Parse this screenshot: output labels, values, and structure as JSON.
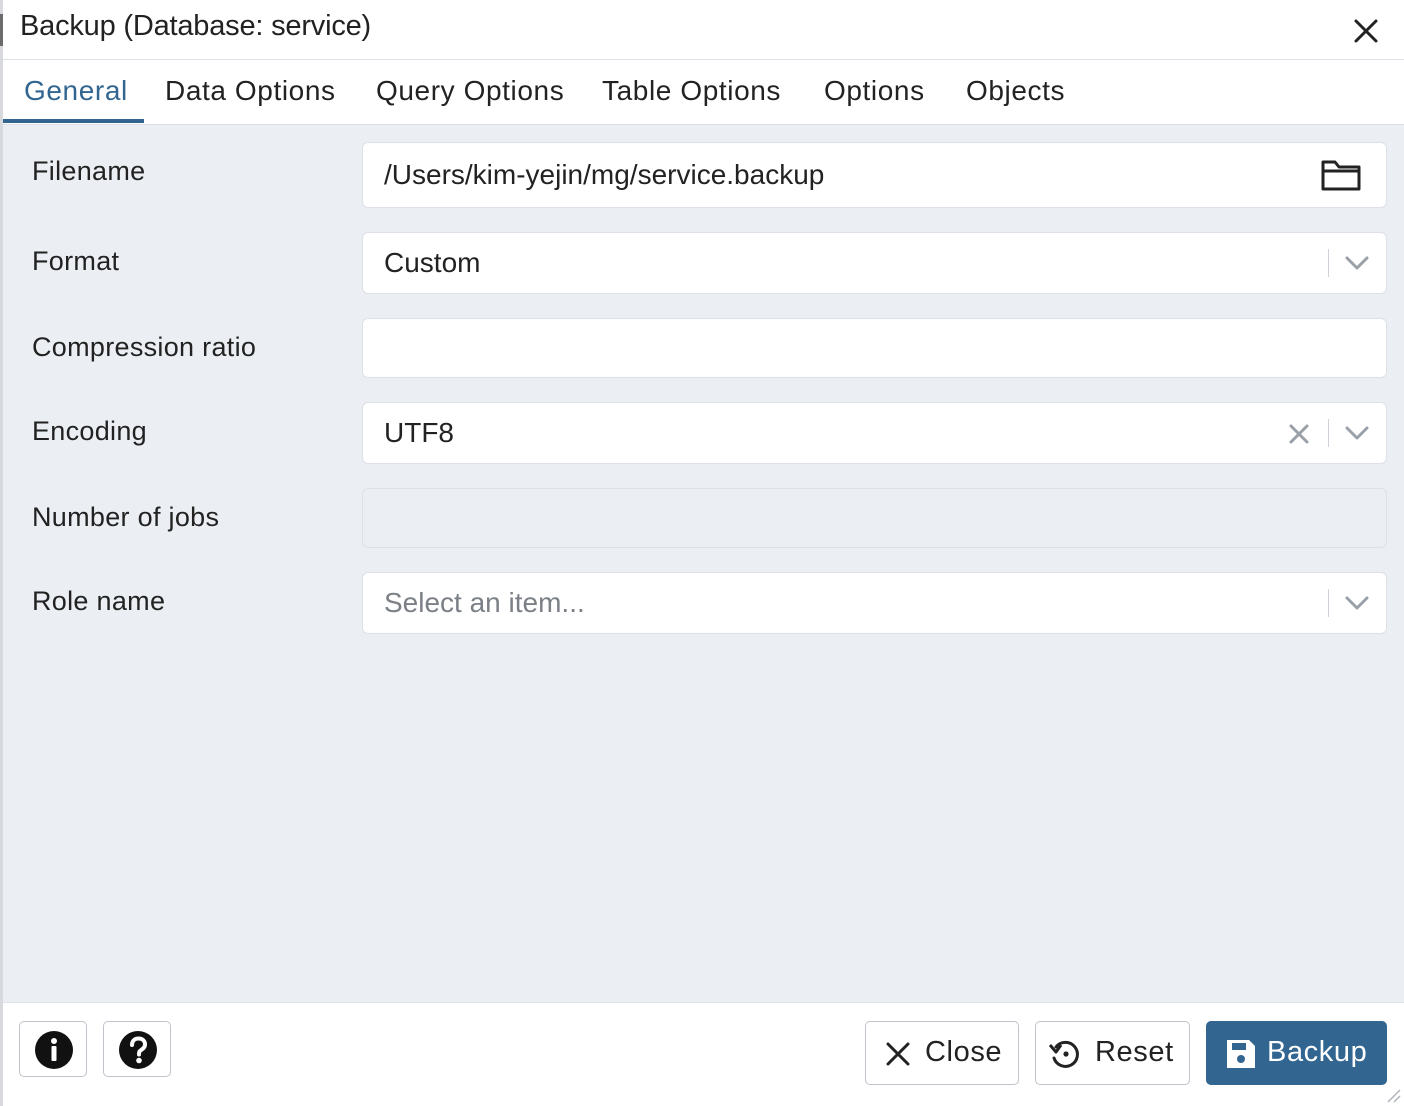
{
  "dialog": {
    "title": "Backup (Database: service)"
  },
  "tabs": [
    {
      "label": "General",
      "active": true
    },
    {
      "label": "Data Options",
      "active": false
    },
    {
      "label": "Query Options",
      "active": false
    },
    {
      "label": "Table Options",
      "active": false
    },
    {
      "label": "Options",
      "active": false
    },
    {
      "label": "Objects",
      "active": false
    }
  ],
  "form": {
    "filename": {
      "label": "Filename",
      "value": "/Users/kim-yejin/mg/service.backup",
      "icon": "folder-icon"
    },
    "format": {
      "label": "Format",
      "value": "Custom"
    },
    "compression_ratio": {
      "label": "Compression ratio",
      "value": ""
    },
    "encoding": {
      "label": "Encoding",
      "value": "UTF8"
    },
    "number_of_jobs": {
      "label": "Number of jobs",
      "value": "",
      "disabled": true
    },
    "role_name": {
      "label": "Role name",
      "placeholder": "Select an item..."
    }
  },
  "footer": {
    "info_icon": "info-icon",
    "help_icon": "help-icon",
    "close_label": "Close",
    "reset_label": "Reset",
    "backup_label": "Backup"
  },
  "colors": {
    "accent": "#326690",
    "body_background": "#ebeef3",
    "border": "#dde0e6"
  }
}
